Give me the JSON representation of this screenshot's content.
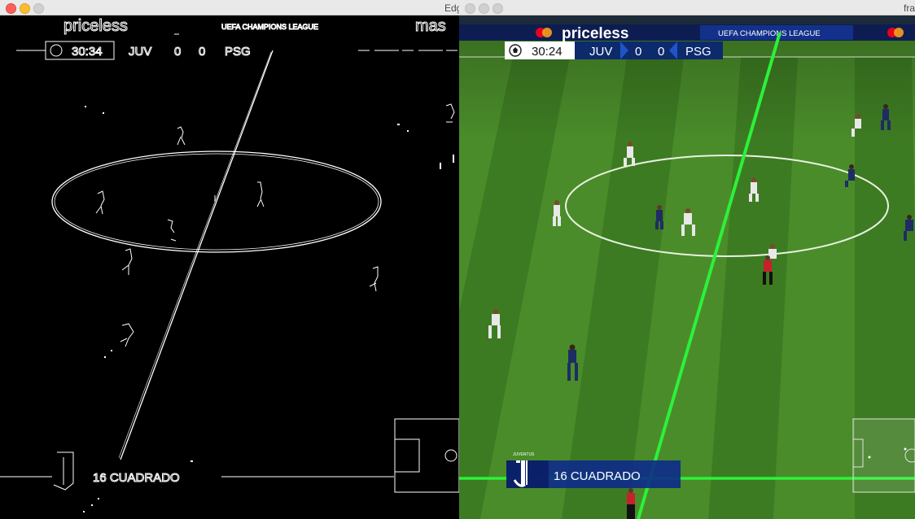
{
  "windows": {
    "left": {
      "title": "Edg"
    },
    "right": {
      "title": "fra"
    }
  },
  "banner": {
    "sponsor": "priceless",
    "competition": "UEFA CHAMPIONS LEAGUE",
    "sponsor_right_partial": "mas"
  },
  "scoreboard_left": {
    "clock": "30:34",
    "home": "JUV",
    "home_score": "0",
    "away_score": "0",
    "away": "PSG"
  },
  "scoreboard_right": {
    "clock": "30:24",
    "home": "JUV",
    "home_score": "0",
    "away_score": "0",
    "away": "PSG"
  },
  "player_caption": {
    "club_label": "JUVENTUS",
    "left_text": "16 CUADRADO",
    "right_text": "16 CUADRADO"
  },
  "colors": {
    "pitch_light": "#4c8f2c",
    "pitch_dark": "#3c7a22",
    "detected_line": "#2cf13a",
    "banner_bg": "#0a2a6e",
    "mastercard_red": "#eb001b",
    "mastercard_orange": "#f79e1b"
  },
  "icons": [
    "ball-icon",
    "juventus-logo",
    "mastercard-logo"
  ]
}
